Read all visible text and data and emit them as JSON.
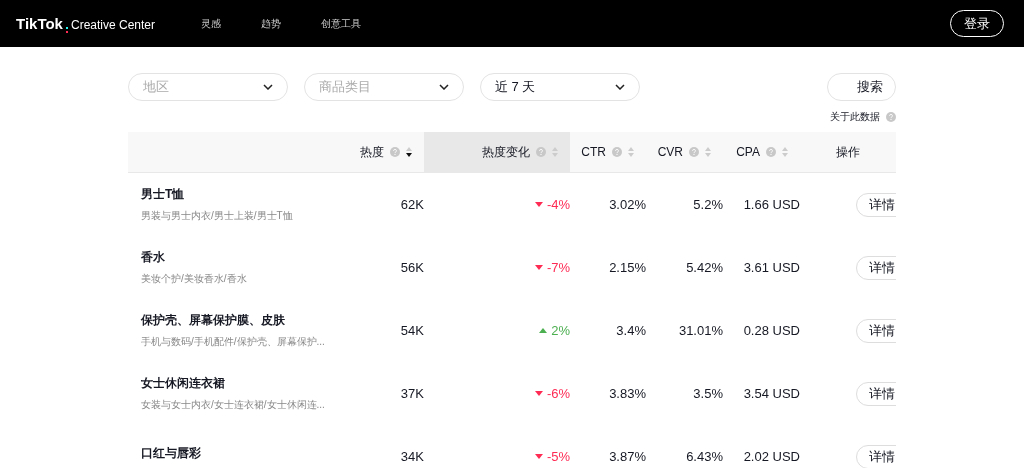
{
  "nav": {
    "logo_brand": "TikTok",
    "logo_suffix": "Creative Center",
    "links": [
      "灵感",
      "趋势",
      "创意工具"
    ],
    "login": "登录"
  },
  "filters": [
    {
      "placeholder": "地区"
    },
    {
      "placeholder": "商品类目"
    },
    {
      "value": "近 7 天"
    }
  ],
  "search_button": "搜索",
  "about_data": "关于此数据",
  "table": {
    "columns": [
      {
        "kind": "blank"
      },
      {
        "kind": "sortable",
        "label": "热度",
        "sorted": true,
        "highlighted": false
      },
      {
        "kind": "sortable",
        "label": "热度变化",
        "sorted": false,
        "highlighted": true
      },
      {
        "kind": "sortable",
        "label": "CTR",
        "sorted": false,
        "highlighted": false
      },
      {
        "kind": "sortable",
        "label": "CVR",
        "sorted": false,
        "highlighted": false
      },
      {
        "kind": "sortable",
        "label": "CPA",
        "sorted": false,
        "highlighted": false
      },
      {
        "kind": "plain",
        "label": "操作"
      }
    ],
    "rows": [
      {
        "name": "男士T恤",
        "path": "男装与男士内衣/男士上装/男士T恤",
        "heat": "62K",
        "change": "-4%",
        "kind": "down",
        "ctr": "3.02%",
        "cvr": "5.2%",
        "cpa": "1.66 USD",
        "action": "详情"
      },
      {
        "name": "香水",
        "path": "美妆个护/美妆香水/香水",
        "heat": "56K",
        "change": "-7%",
        "kind": "down",
        "ctr": "2.15%",
        "cvr": "5.42%",
        "cpa": "3.61 USD",
        "action": "详情"
      },
      {
        "name": "保护壳、屏幕保护膜、皮肤",
        "path": "手机与数码/手机配件/保护壳、屏幕保护...",
        "heat": "54K",
        "change": "2%",
        "kind": "up",
        "ctr": "3.4%",
        "cvr": "31.01%",
        "cpa": "0.28 USD",
        "action": "详情"
      },
      {
        "name": "女士休闲连衣裙",
        "path": "女装与女士内衣/女士连衣裙/女士休闲连...",
        "heat": "37K",
        "change": "-6%",
        "kind": "down",
        "ctr": "3.83%",
        "cvr": "3.5%",
        "cpa": "3.54 USD",
        "action": "详情"
      },
      {
        "name": "口红与唇彩",
        "heat": "34K",
        "change": "-5%",
        "kind": "down",
        "ctr": "3.87%",
        "cvr": "6.43%",
        "cpa": "2.02 USD",
        "action": "详情"
      }
    ]
  }
}
